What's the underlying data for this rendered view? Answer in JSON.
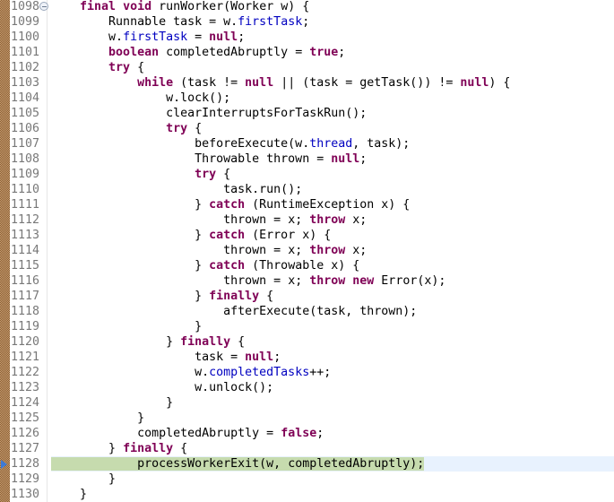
{
  "editor": {
    "highlight_colors": {
      "current_line_text": "#c6dbae",
      "current_line_row": "#e8f2fe",
      "keyword": "#7f0055",
      "field": "#0000c0",
      "line_number": "#787878"
    },
    "current_line_number": "1128",
    "lines": [
      {
        "n": "1098",
        "indent": 1,
        "fold": true,
        "tokens": [
          [
            "kw",
            "final"
          ],
          [
            "t",
            " "
          ],
          [
            "kw",
            "void"
          ],
          [
            "t",
            " runWorker(Worker w) {"
          ]
        ]
      },
      {
        "n": "1099",
        "indent": 2,
        "tokens": [
          [
            "t",
            "Runnable task = w."
          ],
          [
            "fld",
            "firstTask"
          ],
          [
            "t",
            ";"
          ]
        ]
      },
      {
        "n": "1100",
        "indent": 2,
        "tokens": [
          [
            "t",
            "w."
          ],
          [
            "fld",
            "firstTask"
          ],
          [
            "t",
            " = "
          ],
          [
            "kw",
            "null"
          ],
          [
            "t",
            ";"
          ]
        ]
      },
      {
        "n": "1101",
        "indent": 2,
        "tokens": [
          [
            "kw",
            "boolean"
          ],
          [
            "t",
            " completedAbruptly = "
          ],
          [
            "kw",
            "true"
          ],
          [
            "t",
            ";"
          ]
        ]
      },
      {
        "n": "1102",
        "indent": 2,
        "tokens": [
          [
            "kw",
            "try"
          ],
          [
            "t",
            " {"
          ]
        ]
      },
      {
        "n": "1103",
        "indent": 3,
        "tokens": [
          [
            "kw",
            "while"
          ],
          [
            "t",
            " (task != "
          ],
          [
            "kw",
            "null"
          ],
          [
            "t",
            " || (task = getTask()) != "
          ],
          [
            "kw",
            "null"
          ],
          [
            "t",
            ") {"
          ]
        ]
      },
      {
        "n": "1104",
        "indent": 4,
        "tokens": [
          [
            "t",
            "w.lock();"
          ]
        ]
      },
      {
        "n": "1105",
        "indent": 4,
        "tokens": [
          [
            "t",
            "clearInterruptsForTaskRun();"
          ]
        ]
      },
      {
        "n": "1106",
        "indent": 4,
        "tokens": [
          [
            "kw",
            "try"
          ],
          [
            "t",
            " {"
          ]
        ]
      },
      {
        "n": "1107",
        "indent": 5,
        "tokens": [
          [
            "t",
            "beforeExecute(w."
          ],
          [
            "fld",
            "thread"
          ],
          [
            "t",
            ", task);"
          ]
        ]
      },
      {
        "n": "1108",
        "indent": 5,
        "tokens": [
          [
            "t",
            "Throwable thrown = "
          ],
          [
            "kw",
            "null"
          ],
          [
            "t",
            ";"
          ]
        ]
      },
      {
        "n": "1109",
        "indent": 5,
        "tokens": [
          [
            "kw",
            "try"
          ],
          [
            "t",
            " {"
          ]
        ]
      },
      {
        "n": "1110",
        "indent": 6,
        "tokens": [
          [
            "t",
            "task.run();"
          ]
        ]
      },
      {
        "n": "1111",
        "indent": 5,
        "tokens": [
          [
            "t",
            "} "
          ],
          [
            "kw",
            "catch"
          ],
          [
            "t",
            " (RuntimeException x) {"
          ]
        ]
      },
      {
        "n": "1112",
        "indent": 6,
        "tokens": [
          [
            "t",
            "thrown = x; "
          ],
          [
            "kw",
            "throw"
          ],
          [
            "t",
            " x;"
          ]
        ]
      },
      {
        "n": "1113",
        "indent": 5,
        "tokens": [
          [
            "t",
            "} "
          ],
          [
            "kw",
            "catch"
          ],
          [
            "t",
            " (Error x) {"
          ]
        ]
      },
      {
        "n": "1114",
        "indent": 6,
        "tokens": [
          [
            "t",
            "thrown = x; "
          ],
          [
            "kw",
            "throw"
          ],
          [
            "t",
            " x;"
          ]
        ]
      },
      {
        "n": "1115",
        "indent": 5,
        "tokens": [
          [
            "t",
            "} "
          ],
          [
            "kw",
            "catch"
          ],
          [
            "t",
            " (Throwable x) {"
          ]
        ]
      },
      {
        "n": "1116",
        "indent": 6,
        "tokens": [
          [
            "t",
            "thrown = x; "
          ],
          [
            "kw",
            "throw"
          ],
          [
            "t",
            " "
          ],
          [
            "kw",
            "new"
          ],
          [
            "t",
            " Error(x);"
          ]
        ]
      },
      {
        "n": "1117",
        "indent": 5,
        "tokens": [
          [
            "t",
            "} "
          ],
          [
            "kw",
            "finally"
          ],
          [
            "t",
            " {"
          ]
        ]
      },
      {
        "n": "1118",
        "indent": 6,
        "tokens": [
          [
            "t",
            "afterExecute(task, thrown);"
          ]
        ]
      },
      {
        "n": "1119",
        "indent": 5,
        "tokens": [
          [
            "t",
            "}"
          ]
        ]
      },
      {
        "n": "1120",
        "indent": 4,
        "tokens": [
          [
            "t",
            "} "
          ],
          [
            "kw",
            "finally"
          ],
          [
            "t",
            " {"
          ]
        ]
      },
      {
        "n": "1121",
        "indent": 5,
        "tokens": [
          [
            "t",
            "task = "
          ],
          [
            "kw",
            "null"
          ],
          [
            "t",
            ";"
          ]
        ]
      },
      {
        "n": "1122",
        "indent": 5,
        "tokens": [
          [
            "t",
            "w."
          ],
          [
            "fld",
            "completedTasks"
          ],
          [
            "t",
            "++;"
          ]
        ]
      },
      {
        "n": "1123",
        "indent": 5,
        "tokens": [
          [
            "t",
            "w.unlock();"
          ]
        ]
      },
      {
        "n": "1124",
        "indent": 4,
        "tokens": [
          [
            "t",
            "}"
          ]
        ]
      },
      {
        "n": "1125",
        "indent": 3,
        "tokens": [
          [
            "t",
            "}"
          ]
        ]
      },
      {
        "n": "1126",
        "indent": 3,
        "tokens": [
          [
            "t",
            "completedAbruptly = "
          ],
          [
            "kw",
            "false"
          ],
          [
            "t",
            ";"
          ]
        ]
      },
      {
        "n": "1127",
        "indent": 2,
        "tokens": [
          [
            "t",
            "} "
          ],
          [
            "kw",
            "finally"
          ],
          [
            "t",
            " {"
          ]
        ]
      },
      {
        "n": "1128",
        "indent": 3,
        "current": true,
        "tokens": [
          [
            "t",
            "processWorkerExit(w, completedAbruptly);"
          ]
        ]
      },
      {
        "n": "1129",
        "indent": 2,
        "tokens": [
          [
            "t",
            "}"
          ]
        ]
      },
      {
        "n": "1130",
        "indent": 1,
        "tokens": [
          [
            "t",
            "}"
          ]
        ]
      }
    ]
  }
}
